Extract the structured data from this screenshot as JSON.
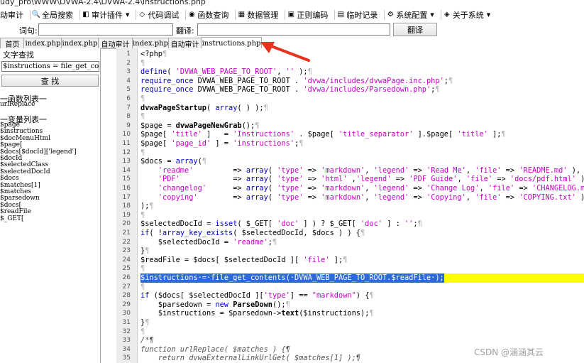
{
  "window_title": "udy_pro\\WWW\\DVWA-2.4\\DVWA-2.4\\instructions.php",
  "menu": [
    {
      "icon": "audit-icon",
      "label": "动审计",
      "caret": false
    },
    {
      "icon": "search-icon",
      "label": "全局搜索",
      "caret": false
    },
    {
      "icon": "plugin-icon",
      "label": "审计插件",
      "caret": true
    },
    {
      "icon": "code-debug-icon",
      "label": "代码调试",
      "caret": false
    },
    {
      "icon": "function-query-icon",
      "label": "函数查询",
      "caret": false
    },
    {
      "icon": "database-icon",
      "label": "数据管理",
      "caret": false
    },
    {
      "icon": "regex-icon",
      "label": "正则编码",
      "caret": false
    },
    {
      "icon": "temp-record-icon",
      "label": "临时记录",
      "caret": false
    },
    {
      "icon": "gear-icon",
      "label": "系统配置",
      "caret": true
    },
    {
      "icon": "about-icon",
      "label": "关于系统",
      "caret": true
    }
  ],
  "search": {
    "word_label": "词句:",
    "translate_label": "翻译:",
    "translate_button": "翻译",
    "word_value": "",
    "translate_value": ""
  },
  "tabs": [
    {
      "label": "首页",
      "mono": false,
      "active": false
    },
    {
      "label": "index.php",
      "mono": true,
      "active": false
    },
    {
      "label": "index.php",
      "mono": true,
      "active": false
    },
    {
      "label": "自动审计",
      "mono": false,
      "active": false
    },
    {
      "label": "index.php",
      "mono": true,
      "active": false
    },
    {
      "label": "自动审计",
      "mono": false,
      "active": false
    },
    {
      "label": "instructions.php",
      "mono": true,
      "active": true
    }
  ],
  "left_panel": {
    "text_search_title": "文字查找",
    "search_value": "$instructions = file_get_cor",
    "search_button": "查 找",
    "function_list_title": "一函数列表一",
    "functions": [
      "urlReplace"
    ],
    "variable_list_title": "一变量列表一",
    "variables": [
      "$page",
      "$instructions",
      "$docMenuHtml",
      "$page[",
      "$docs[$docId]['legend']",
      "$docId",
      "$selectedClass",
      "$selectedDocId",
      "$docs",
      "$matches[1]",
      "$matches",
      "$parsedown",
      "$docs[",
      "$readFile",
      "$_GET["
    ]
  },
  "editor": {
    "highlight_line": 26,
    "lines": [
      {
        "n": "1",
        "t": "<?php¶"
      },
      {
        "n": "2",
        "t": "¶"
      },
      {
        "n": "3",
        "t": "define( 'DVWA_WEB_PAGE_TO_ROOT', '' );¶"
      },
      {
        "n": "4",
        "t": "require_once DVWA_WEB_PAGE_TO_ROOT . 'dvwa/includes/dvwaPage.inc.php';¶"
      },
      {
        "n": "5",
        "t": "require_once DVWA_WEB_PAGE_TO_ROOT . 'dvwa/includes/Parsedown.php';¶"
      },
      {
        "n": "6",
        "t": "¶"
      },
      {
        "n": "7",
        "t": "dvwaPageStartup( array( ) );¶"
      },
      {
        "n": "8",
        "t": "¶"
      },
      {
        "n": "9",
        "t": "$page = dvwaPageNewGrab();¶"
      },
      {
        "n": "10",
        "t": "$page[ 'title' ]   = 'Instructions' . $page[ 'title_separator' ].$page[ 'title' ];¶"
      },
      {
        "n": "11",
        "t": "$page[ 'page_id' ] = 'instructions';¶"
      },
      {
        "n": "12",
        "t": "¶"
      },
      {
        "n": "13",
        "t": "$docs = array(¶"
      },
      {
        "n": "14",
        "t": "    'readme'         => array( 'type' => 'markdown', 'legend' => 'Read Me', 'file' => 'README.md' ),"
      },
      {
        "n": "15",
        "t": "    'PDF'            => array( 'type' => 'html' ,'legend' => 'PDF Guide', 'file' => 'docs/pdf.html' ),"
      },
      {
        "n": "16",
        "t": "    'changelog'      => array( 'type' => 'markdown', 'legend' => 'Change Log', 'file' => 'CHANGELOG.md' ),"
      },
      {
        "n": "17",
        "t": "    'copying'        => array( 'type' => 'markdown', 'legend' => 'Copying', 'file' => 'COPYING.txt' ),"
      },
      {
        "n": "18",
        "t": ");¶"
      },
      {
        "n": "19",
        "t": "¶"
      },
      {
        "n": "20",
        "t": "$selectedDocId = isset( $_GET[ 'doc' ] ) ? $_GET[ 'doc' ] : '';¶"
      },
      {
        "n": "21",
        "t": "if( !array_key_exists( $selectedDocId, $docs ) ) {¶"
      },
      {
        "n": "22",
        "t": "    $selectedDocId = 'readme';¶"
      },
      {
        "n": "23",
        "t": "}¶"
      },
      {
        "n": "24",
        "t": "$readFile = $docs[ $selectedDocId ][ 'file' ];¶"
      },
      {
        "n": "25",
        "t": "¶"
      },
      {
        "n": "26",
        "t": "$instructions = file_get_contents( DVWA_WEB_PAGE_TO_ROOT.$readFile );¶"
      },
      {
        "n": "27",
        "t": "¶"
      },
      {
        "n": "28",
        "t": "if ($docs[ $selectedDocId ]['type'] == \"markdown\") {¶"
      },
      {
        "n": "29",
        "t": "    $parsedown = new ParseDown();¶"
      },
      {
        "n": "30",
        "t": "    $instructions = $parsedown->text($instructions);¶"
      },
      {
        "n": "31",
        "t": "}¶"
      },
      {
        "n": "32",
        "t": "¶"
      },
      {
        "n": "33",
        "t": "/*¶"
      },
      {
        "n": "34",
        "t": "function urlReplace( $matches ) {¶"
      },
      {
        "n": "35",
        "t": "    return dvwaExternalLinkUrlGet( $matches[1] );¶"
      }
    ]
  },
  "watermark": "CSDN @涵涵其云",
  "colors": {
    "keyword": "#0000c8",
    "string": "#c800c8",
    "highlight": "#ffff00",
    "selection": "#2e6ad6",
    "arrow": "#e8321e",
    "comment": "#555555",
    "default": "#000000"
  }
}
